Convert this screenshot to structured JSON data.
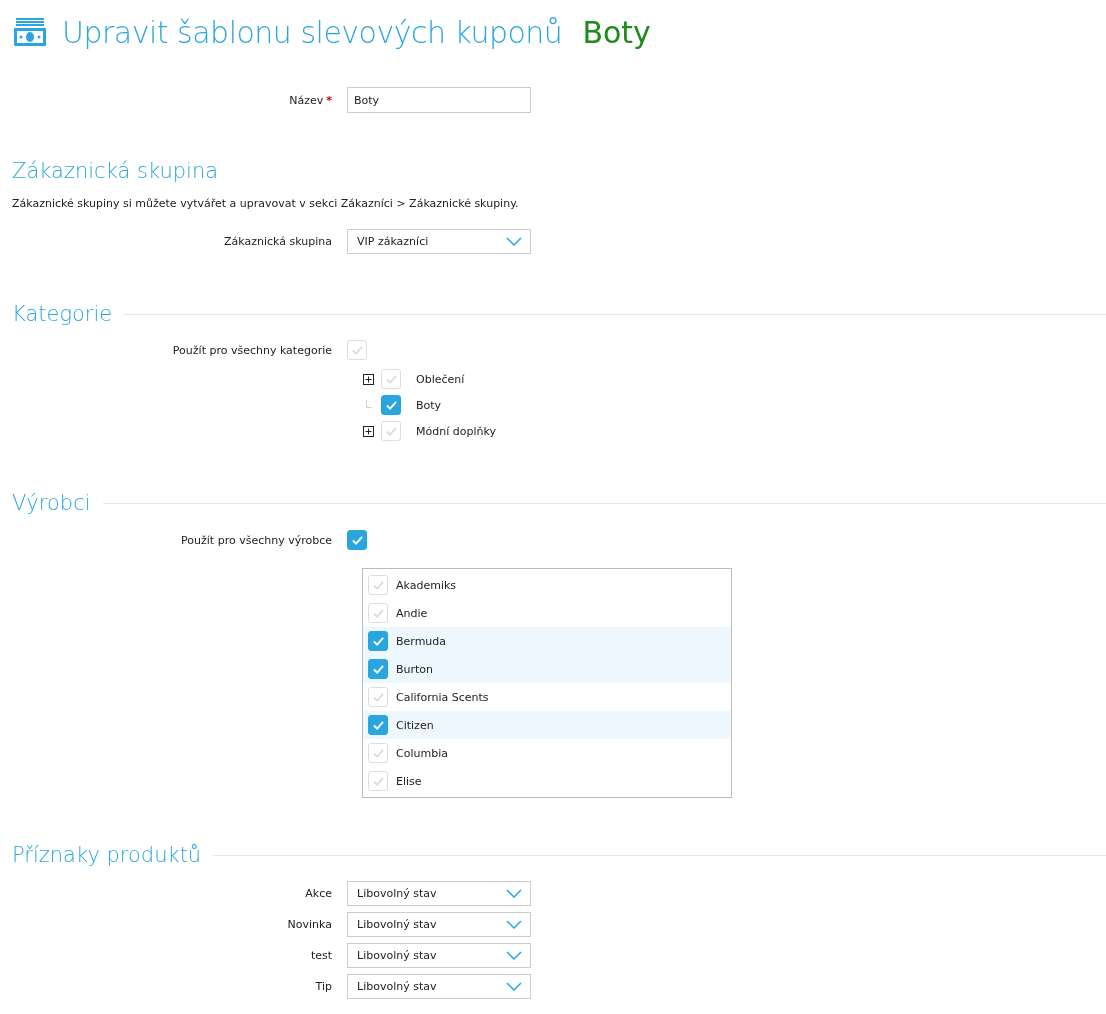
{
  "title": {
    "text": "Upravit šablonu slevových kuponů",
    "subject": "Boty"
  },
  "name_field": {
    "label": "Název",
    "required_mark": "*",
    "value": "Boty"
  },
  "customer_group": {
    "heading": "Zákaznická skupina",
    "description": "Zákaznické skupiny si můžete vytvářet a upravovat v sekci Zákazníci > Zákaznické skupiny.",
    "label": "Zákaznická skupina",
    "value": "VIP zákazníci"
  },
  "categories": {
    "heading": "Kategorie",
    "all_label": "Použít pro všechny kategorie",
    "all_checked": false,
    "items": [
      {
        "label": "Oblečení",
        "kind": "branch",
        "checked": false
      },
      {
        "label": "Boty",
        "kind": "leaf",
        "checked": true
      },
      {
        "label": "Módní doplňky",
        "kind": "branch",
        "checked": false
      }
    ]
  },
  "manufacturers": {
    "heading": "Výrobci",
    "all_label": "Použít pro všechny výrobce",
    "all_checked": true,
    "items": [
      {
        "label": "Akademiks",
        "checked": false
      },
      {
        "label": "Andie",
        "checked": false
      },
      {
        "label": "Bermuda",
        "checked": true
      },
      {
        "label": "Burton",
        "checked": true
      },
      {
        "label": "California Scents",
        "checked": false
      },
      {
        "label": "Citizen",
        "checked": true
      },
      {
        "label": "Columbia",
        "checked": false
      },
      {
        "label": "Elise",
        "checked": false
      }
    ]
  },
  "product_flags": {
    "heading": "Příznaky produktů",
    "items": [
      {
        "label": "Akce",
        "value": "Libovolný stav"
      },
      {
        "label": "Novinka",
        "value": "Libovolný stav"
      },
      {
        "label": "test",
        "value": "Libovolný stav"
      },
      {
        "label": "Tip",
        "value": "Libovolný stav"
      }
    ]
  }
}
